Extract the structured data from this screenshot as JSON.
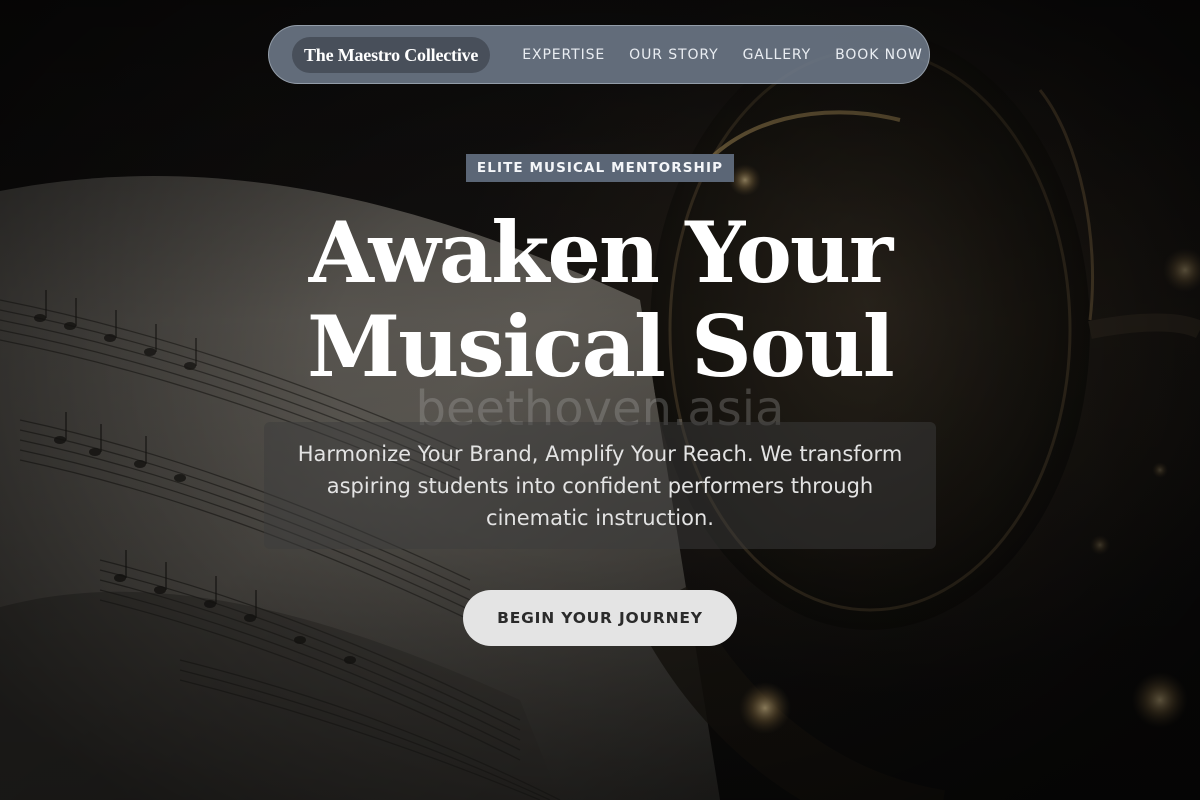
{
  "nav": {
    "brand": "The Maestro Collective",
    "links": [
      "EXPERTISE",
      "OUR STORY",
      "GALLERY",
      "BOOK NOW"
    ]
  },
  "hero": {
    "badge": "ELITE MUSICAL MENTORSHIP",
    "headline_line1": "Awaken Your",
    "headline_line2": "Musical Soul",
    "watermark": "beethoven.asia",
    "subtitle": "Harmonize Your Brand, Amplify Your Reach. We transform aspiring students into confident performers through cinematic instruction.",
    "cta": "BEGIN YOUR JOURNEY"
  },
  "background": {
    "image": "sheet-music-and-trumpet-photo"
  },
  "colors": {
    "nav_bg": "#6e7a8a",
    "badge_bg": "#5b6676",
    "cta_bg": "#e4e4e4",
    "headline": "#ffffff"
  }
}
